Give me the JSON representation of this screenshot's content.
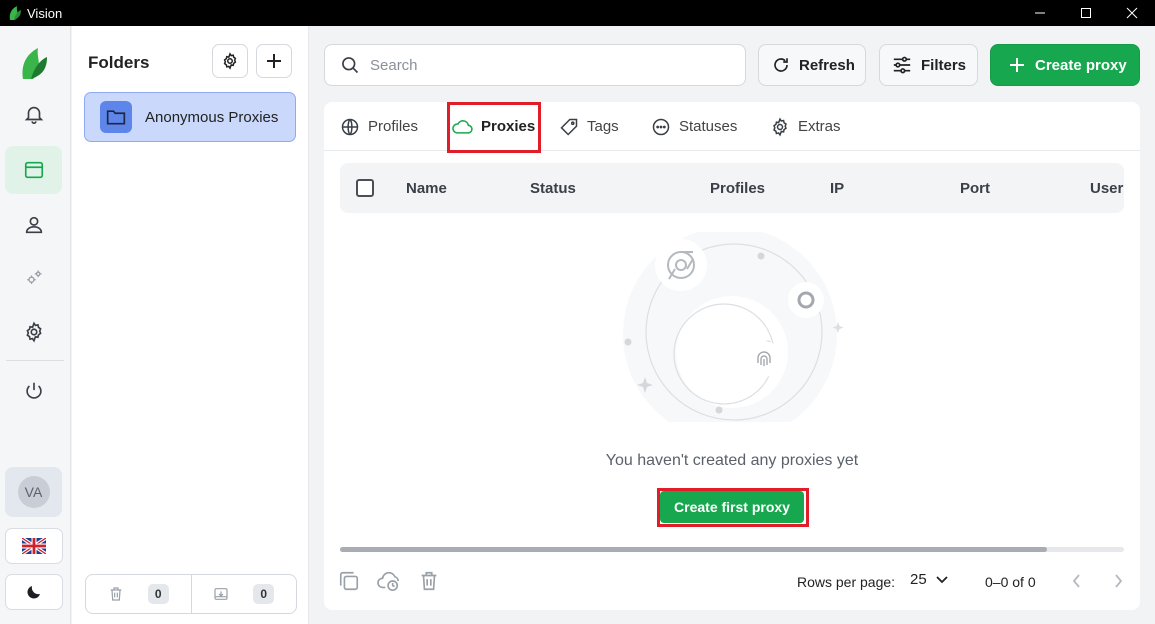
{
  "window": {
    "title": "Vision"
  },
  "sidebar": {
    "user_initials": "VA"
  },
  "folders": {
    "title": "Folders",
    "items": [
      {
        "label": "Anonymous Proxies"
      }
    ],
    "trash_count": "0",
    "archive_count": "0"
  },
  "toolbar": {
    "search_placeholder": "Search",
    "refresh_label": "Refresh",
    "filters_label": "Filters",
    "create_label": "Create proxy"
  },
  "tabs": [
    {
      "label": "Profiles"
    },
    {
      "label": "Proxies",
      "active": true
    },
    {
      "label": "Tags"
    },
    {
      "label": "Statuses"
    },
    {
      "label": "Extras"
    }
  ],
  "table": {
    "columns": [
      "Name",
      "Status",
      "Profiles",
      "IP",
      "Port",
      "Usern"
    ]
  },
  "empty_state": {
    "message": "You haven't created any proxies yet",
    "button_label": "Create first proxy"
  },
  "footer": {
    "rows_per_page_label": "Rows per page:",
    "rows_per_page_value": "25",
    "page_info": "0–0 of 0"
  },
  "colors": {
    "accent": "#17a84f",
    "highlight": "#e11d2a",
    "folder_selected": "#c9d8fb"
  }
}
